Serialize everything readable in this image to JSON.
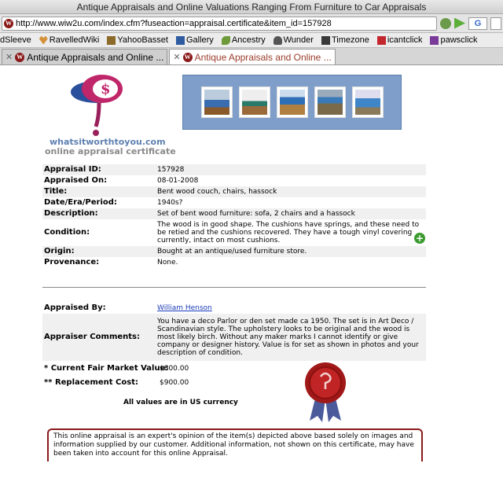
{
  "window": {
    "title": "Antique Appraisals and Online Valuations Ranging From Furniture to Car Appraisals"
  },
  "nav": {
    "url": "http://www.wiw2u.com/index.cfm?fuseaction=appraisal.certificate&item_id=157928"
  },
  "bookmarks": [
    "dSleeve",
    "RavelledWiki",
    "YahooBasset",
    "Gallery",
    "Ancestry",
    "Wunder",
    "Timezone",
    "icantclick",
    "pawsclick"
  ],
  "tabs": [
    {
      "label": "Antique Appraisals and Online ...",
      "active": false
    },
    {
      "label": "Antique Appraisals and Online ...",
      "active": true
    }
  ],
  "site": {
    "url": "whatsitworthtoyou.com",
    "subtitle": "online appraisal certificate"
  },
  "info": [
    {
      "label": "Appraisal ID:",
      "value": "157928"
    },
    {
      "label": "Appraised On:",
      "value": "08-01-2008"
    },
    {
      "label": "Title:",
      "value": "Bent wood couch, chairs, hassock"
    },
    {
      "label": "Date/Era/Period:",
      "value": "1940s?"
    },
    {
      "label": "Description:",
      "value": "Set of bent wood furniture: sofa, 2 chairs and a hassock"
    },
    {
      "label": "Condition:",
      "value": "The wood is in good shape. The cushions have springs, and these need to be retied and the cushions recovered. They have a tough vinyl covering currently, intact on most cushions."
    },
    {
      "label": "Origin:",
      "value": "Bought at an antique/used furniture store."
    },
    {
      "label": "Provenance:",
      "value": "None."
    }
  ],
  "appraisal": {
    "by_label": "Appraised By:",
    "by_value": "William Henson",
    "comments_label": "Appraiser Comments:",
    "comments_value": "You have a deco Parlor or den set made ca 1950. The set is in Art Deco / Scandinavian style. The upholstery looks to be original and the wood is most likely birch. Without any maker marks I cannot identify or give company or designer history. Value is for set as shown in photos and your description of condition.",
    "fmv_label": "* Current Fair Market Value:",
    "fmv_value": "$800.00",
    "replacement_label": "** Replacement Cost:",
    "replacement_value": "$900.00",
    "currency_note": "All values are in US currency"
  },
  "disclaimer": "This online appraisal is an expert's opinion of the item(s) depicted above based solely on images and information supplied by our customer. Additional information, not shown on this certificate, may have been taken into account for this online Appraisal.",
  "colors": {
    "accent": "#8b1a1a",
    "gallery_bg": "#7f9ec9",
    "link": "#1a3bb8"
  }
}
